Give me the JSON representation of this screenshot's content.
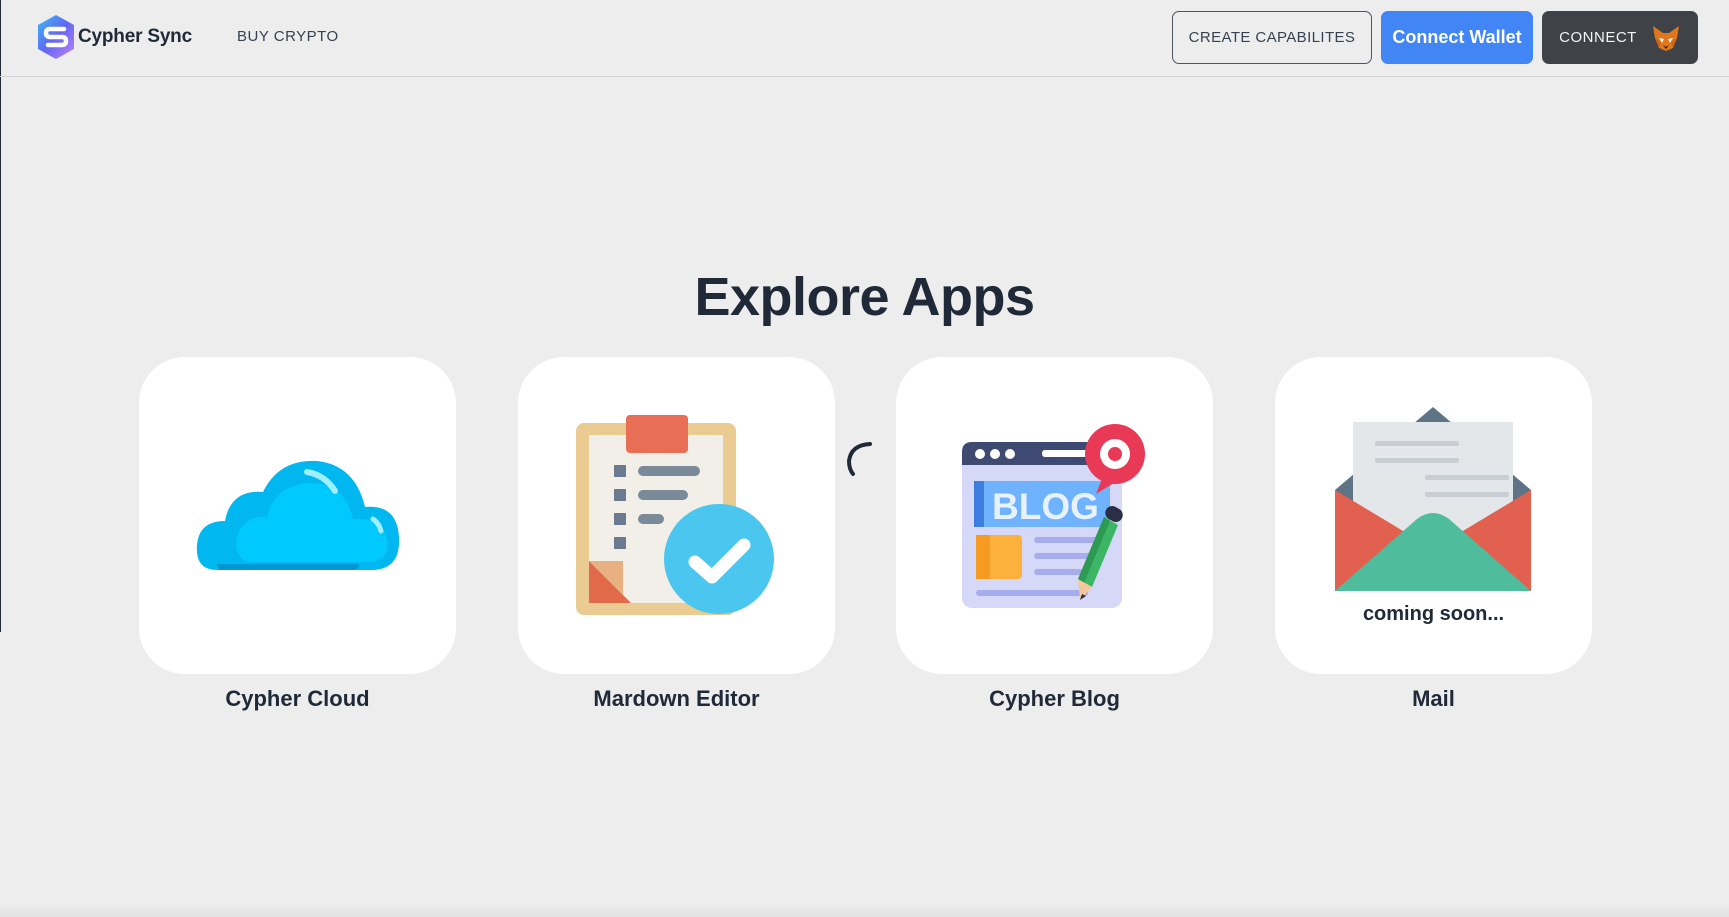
{
  "header": {
    "brand": "Cypher Sync",
    "nav_buy": "BUY CRYPTO",
    "create_label": "CREATE CAPABILITES",
    "wallet_label": "Connect Wallet",
    "connect_label": "CONNECT"
  },
  "main": {
    "title": "Explore Apps",
    "apps": [
      {
        "label": "Cypher Cloud",
        "icon": "cloud-icon"
      },
      {
        "label": "Mardown Editor",
        "icon": "clipboard-check-icon"
      },
      {
        "label": "Cypher Blog",
        "icon": "blog-icon"
      },
      {
        "label": "Mail",
        "icon": "mail-icon",
        "status": "coming soon..."
      }
    ]
  },
  "colors": {
    "accent": "#4285f4",
    "dark_button": "#3f4347",
    "background": "#ededed",
    "card": "#ffffff",
    "text": "#1f2937"
  }
}
